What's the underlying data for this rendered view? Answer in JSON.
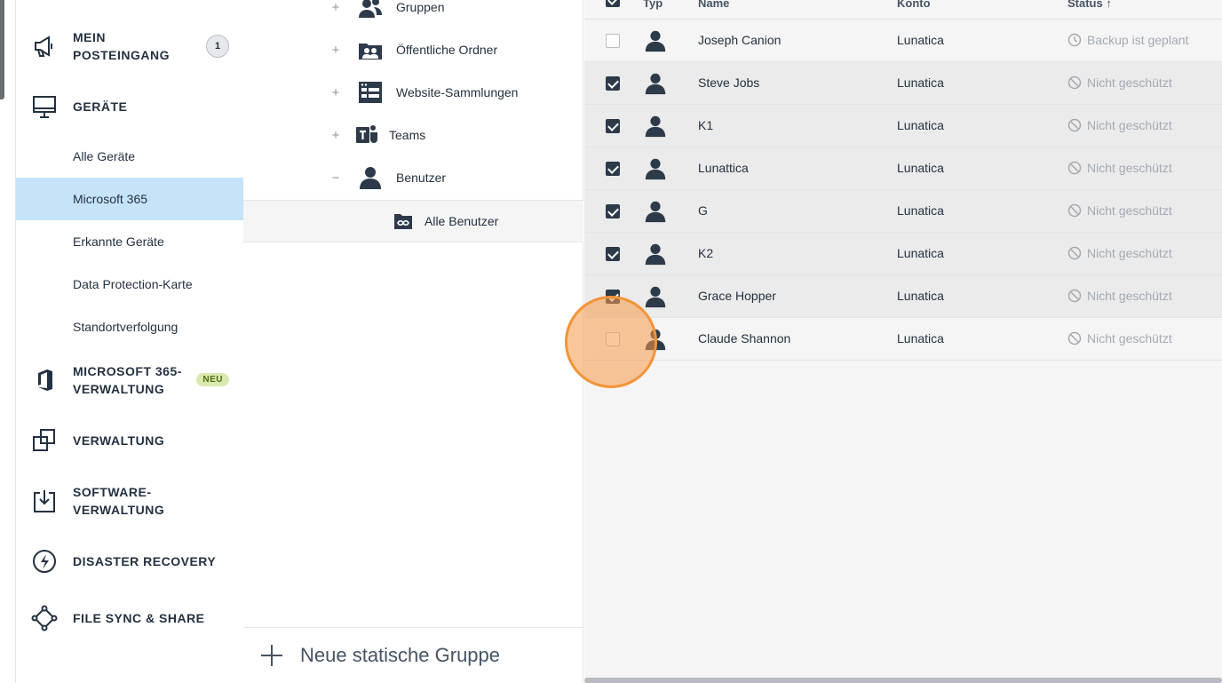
{
  "sidebar": {
    "inbox": {
      "label_line1": "MEIN",
      "label_line2": "POSTEINGANG",
      "count": "1"
    },
    "devices": {
      "label": "GERÄTE"
    },
    "sub_items": [
      {
        "label": "Alle Geräte"
      },
      {
        "label": "Microsoft 365"
      },
      {
        "label": "Erkannte Geräte"
      },
      {
        "label": "Data Protection-Karte"
      },
      {
        "label": "Standortverfolgung"
      }
    ],
    "m365_admin": {
      "label_line1": "MICROSOFT 365-",
      "label_line2": "VERWALTUNG",
      "badge": "NEU"
    },
    "management": {
      "label": "VERWALTUNG"
    },
    "software": {
      "label_line1": "SOFTWARE-",
      "label_line2": "VERWALTUNG"
    },
    "disaster": {
      "label": "DISASTER RECOVERY"
    },
    "filesync": {
      "label": "FILE SYNC & SHARE"
    }
  },
  "tree": {
    "items": [
      {
        "toggle": "+",
        "label": "Gruppen",
        "icon": "group-icon"
      },
      {
        "toggle": "+",
        "label": "Öffentliche Ordner",
        "icon": "public-folder-icon"
      },
      {
        "toggle": "+",
        "label": "Website-Sammlungen",
        "icon": "website-icon"
      },
      {
        "toggle": "+",
        "label": "Teams",
        "icon": "teams-icon"
      },
      {
        "toggle": "−",
        "label": "Benutzer",
        "icon": "user-icon"
      }
    ],
    "selected_child": {
      "label": "Alle Benutzer",
      "icon": "all-users-folder-icon"
    },
    "footer_label": "Neue statische Gruppe"
  },
  "table": {
    "headers": {
      "type": "Typ",
      "name": "Name",
      "account": "Konto",
      "status": "Status ↑"
    },
    "rows": [
      {
        "name": "Joseph Canion",
        "account": "Lunatica",
        "status": "Backup ist geplant",
        "status_icon": "clock-icon",
        "checked": false
      },
      {
        "name": "Steve Jobs",
        "account": "Lunatica",
        "status": "Nicht geschützt",
        "status_icon": "blocked-icon",
        "checked": true
      },
      {
        "name": "K1",
        "account": "Lunatica",
        "status": "Nicht geschützt",
        "status_icon": "blocked-icon",
        "checked": true
      },
      {
        "name": "Lunattica",
        "account": "Lunatica",
        "status": "Nicht geschützt",
        "status_icon": "blocked-icon",
        "checked": true
      },
      {
        "name": "G",
        "account": "Lunatica",
        "status": "Nicht geschützt",
        "status_icon": "blocked-icon",
        "checked": true
      },
      {
        "name": "K2",
        "account": "Lunatica",
        "status": "Nicht geschützt",
        "status_icon": "blocked-icon",
        "checked": true
      },
      {
        "name": "Grace Hopper",
        "account": "Lunatica",
        "status": "Nicht geschützt",
        "status_icon": "blocked-icon",
        "checked": true
      },
      {
        "name": "Claude Shannon",
        "account": "Lunatica",
        "status": "Nicht geschützt",
        "status_icon": "blocked-icon",
        "checked": false
      }
    ]
  },
  "colors": {
    "active_nav": "#c5e4f7",
    "text_dark": "#243142",
    "click_highlight": "#f39439",
    "new_badge": "#d8eab0"
  }
}
